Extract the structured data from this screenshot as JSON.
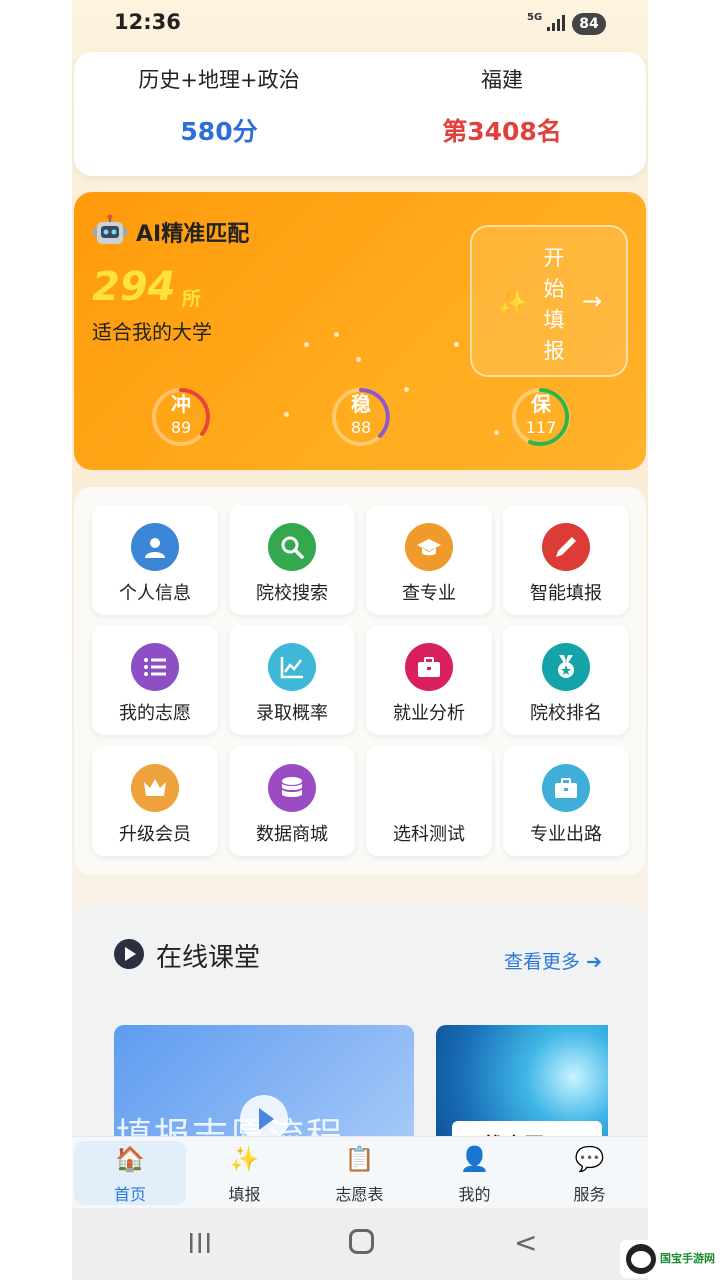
{
  "status_bar": {
    "time": "12:36",
    "network": "5G",
    "battery": "84"
  },
  "score_card": {
    "subjects": "历史+地理+政治",
    "province": "福建",
    "score": "580分",
    "rank": "第3408名"
  },
  "ai_match": {
    "title": "AI精准匹配",
    "count": "294",
    "unit": "所",
    "subtitle": "适合我的大学",
    "start_chars": [
      "开",
      "始",
      "填",
      "报"
    ],
    "start_arrow": "→",
    "rings": [
      {
        "label": "冲",
        "value": "89",
        "color": "#e8443a"
      },
      {
        "label": "稳",
        "value": "88",
        "color": "#8e5ac9"
      },
      {
        "label": "保",
        "value": "117",
        "color": "#2fb44a"
      }
    ]
  },
  "grid": {
    "items": [
      {
        "label": "个人信息",
        "icon": "user-icon",
        "color": "#3b86d6"
      },
      {
        "label": "院校搜索",
        "icon": "search-icon",
        "color": "#34a84f"
      },
      {
        "label": "查专业",
        "icon": "graduation-cap-icon",
        "color": "#ef9a2a"
      },
      {
        "label": "智能填报",
        "icon": "pen-icon",
        "color": "#dc3b36"
      },
      {
        "label": "我的志愿",
        "icon": "list-icon",
        "color": "#8e4ec4"
      },
      {
        "label": "录取概率",
        "icon": "chart-line-icon",
        "color": "#3fb8d8"
      },
      {
        "label": "就业分析",
        "icon": "briefcase-icon",
        "color": "#d8205e"
      },
      {
        "label": "院校排名",
        "icon": "medal-icon",
        "color": "#13a3a8"
      },
      {
        "label": "升级会员",
        "icon": "crown-icon",
        "color": "#eea23b"
      },
      {
        "label": "数据商城",
        "icon": "database-icon",
        "color": "#9b4cc2"
      },
      {
        "label": "选科测试",
        "icon": "",
        "color": ""
      },
      {
        "label": "专业出路",
        "icon": "briefcase-icon",
        "color": "#3faed8"
      }
    ]
  },
  "online_class": {
    "title": "在线课堂",
    "more": "查看更多",
    "thumb1_text": "填报志愿流程",
    "thumb2_caption": "不找志愿"
  },
  "tabbar": {
    "items": [
      {
        "label": "首页",
        "icon": "home-icon",
        "glyph": "🏠"
      },
      {
        "label": "填报",
        "icon": "sparkles-icon",
        "glyph": "✨"
      },
      {
        "label": "志愿表",
        "icon": "clipboard-icon",
        "glyph": "📋"
      },
      {
        "label": "我的",
        "icon": "person-icon",
        "glyph": "👤"
      },
      {
        "label": "服务",
        "icon": "chat-icon",
        "glyph": "💬"
      }
    ]
  },
  "watermark": {
    "text": "国宝手游网"
  }
}
